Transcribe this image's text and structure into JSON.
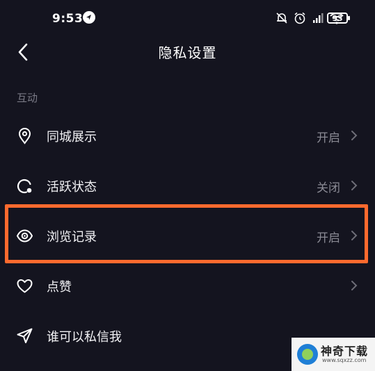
{
  "status_bar": {
    "time": "9:53",
    "battery": "93"
  },
  "header": {
    "title": "隐私设置"
  },
  "section": {
    "label": "互动"
  },
  "items": [
    {
      "label": "同城展示",
      "value": "开启",
      "icon": "location-pin-icon"
    },
    {
      "label": "活跃状态",
      "value": "关闭",
      "icon": "active-status-icon"
    },
    {
      "label": "浏览记录",
      "value": "开启",
      "icon": "eye-icon"
    },
    {
      "label": "点赞",
      "value": "",
      "icon": "heart-icon"
    },
    {
      "label": "谁可以私信我",
      "value": "",
      "icon": "send-icon"
    }
  ],
  "watermark": {
    "name": "神奇下载",
    "url": "www.sqxzz.com"
  },
  "colors": {
    "background": "#14141f",
    "highlight": "#ff6a2e",
    "secondary_text": "#8a8a94"
  }
}
